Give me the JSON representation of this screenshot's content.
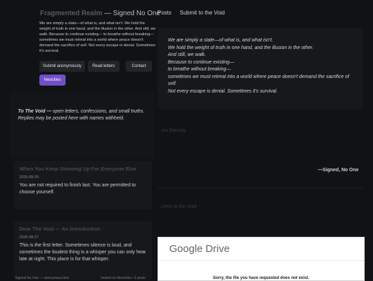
{
  "header": {
    "title_main": "Fragmented Realm",
    "title_sub": "— Signed No One",
    "nav": [
      "Posts",
      "Submit to the Void"
    ]
  },
  "intro": {
    "text": "We are simply a state—of what is, and what isn't. We hold the weight of truth in one hand, and the illusion in the other. And still, we walk. Because to continue existing— to breathe without breaking— sometimes we must retreat into a world where peace doesn't demand the sacrifice of self. Not every escape is denial. Sometimes it's survival.",
    "buttons": [
      "Submit anonymously",
      "Read letters",
      "Contact"
    ],
    "special_button": "Neocities"
  },
  "hero_poem": [
    "We are simply a state—of what is, and what isn't.",
    "We hold the weight of truth in one hand, and the illusion in the other.",
    "And still, we walk.",
    "Because to continue existing—",
    "to breathe without breaking—",
    "sometimes we must retreat into a world where peace doesn't demand the sacrifice of self.",
    "Not every escape is denial. Sometimes it's survival."
  ],
  "void": {
    "title": "To The Void —",
    "text": " open letters, confessions, and small truths. Replies may be posted here with names withheld."
  },
  "background": {
    "heading1": "...ms Eternity",
    "signature": "—Signed, No One",
    "heading2": "...ment to the Void"
  },
  "posts": [
    {
      "title": "When You Keep Showing Up For Everyone Else",
      "date": "2025-08-25",
      "body": "You are not required to finish last. You are permitted to choose yourself."
    },
    {
      "title": "Dear The Void — An Introduction",
      "date": "2025-08-27",
      "body": "This is the first letter. Sometimes silence is loud, and sometimes the loudest thing is a whisper you can only hear late at night. This place is for that whisper."
    }
  ],
  "gdrive": {
    "logo": "Google Drive",
    "message": "Sorry, the file you have requested does not exist."
  },
  "footer": {
    "left": "Signed No One — anonymous hint",
    "right": "hosted on Neocities • 3 posts"
  },
  "colors": {
    "background": "#111214",
    "accent_purple": "#7050c8",
    "card": "#17181b"
  }
}
